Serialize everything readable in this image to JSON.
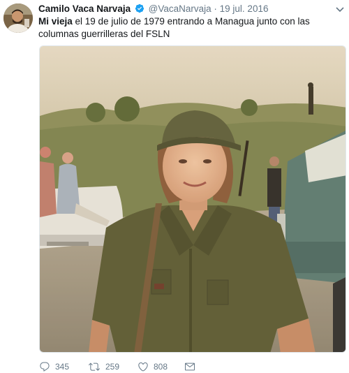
{
  "tweet": {
    "display_name": "Camilo Vaca Narvaja",
    "handle": "@VacaNarvaja",
    "separator": "·",
    "date": "19 jul. 2016",
    "text_bold": "Mi vieja",
    "text_rest": " el 19 de julio de 1979 entrando a Managua junto con las columnas guerrilleras del FSLN",
    "avatar_icon": "profile-photo",
    "verified_icon": "verified-badge-icon",
    "media": {
      "type": "photo",
      "alt": ""
    },
    "stats": {
      "replies": "345",
      "retweets": "259",
      "likes": "808"
    }
  },
  "colors": {
    "text": "#14171a",
    "secondary": "#657786",
    "verified": "#1da1f2"
  }
}
